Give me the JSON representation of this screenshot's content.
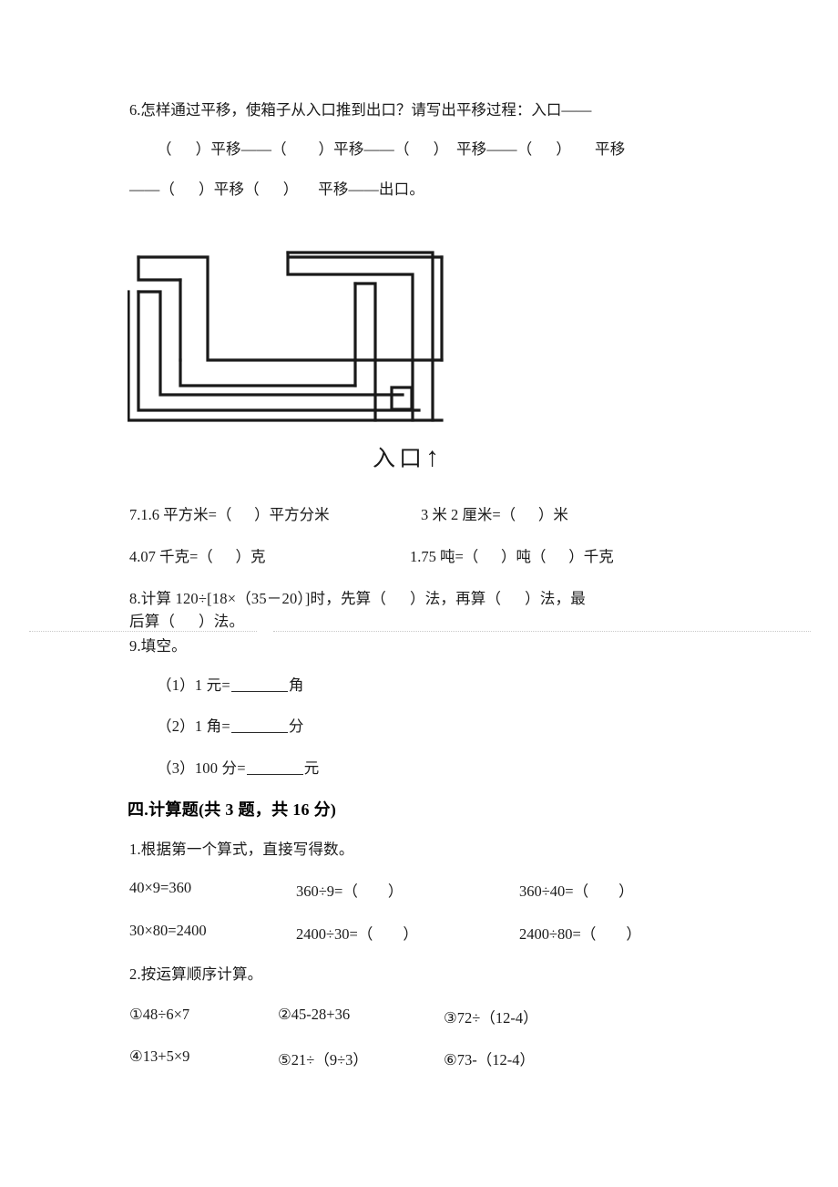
{
  "document": {
    "type": "math-worksheet",
    "language": "zh-CN"
  },
  "questions": {
    "q6": {
      "line1": "6.怎样通过平移，使箱子从入口推到出口？请写出平移过程：入口——",
      "line2": "（      ）平移——（        ）平移——（      ）  平移——（      ）      平移",
      "line3": "——（      ）平移（      ）     平移——出口。"
    },
    "q7": {
      "left1": "7.1.6 平方米=（      ）平方分米",
      "right1": "3 米 2 厘米=（      ）米",
      "left2": "4.07 千克=（      ）克",
      "right2": "1.75 吨=（      ）吨（      ）千克"
    },
    "q8": {
      "line1": "8.计算 120÷[18×（35－20）]时，先算（      ）法，再算（      ）法，最",
      "line2": "后算（      ）法。"
    },
    "q9": {
      "title": "9.填空。",
      "items": [
        {
          "prefix": "（1）1 元=",
          "suffix": "角"
        },
        {
          "prefix": "（2）1 角=",
          "suffix": "分"
        },
        {
          "prefix": "（3）100 分=",
          "suffix": "元"
        }
      ]
    }
  },
  "section4": {
    "title": "四.计算题(共 3 题，共 16 分)",
    "q1": {
      "prompt": "1.根据第一个算式，直接写得数。",
      "rows": [
        {
          "c1": "40×9=360",
          "c2": "360÷9=（        ）",
          "c3": "360÷40=（        ）"
        },
        {
          "c1": "30×80=2400",
          "c2": "2400÷30=（        ）",
          "c3": "2400÷80=（        ）"
        }
      ]
    },
    "q2": {
      "prompt": "2.按运算顺序计算。",
      "rows": [
        {
          "c1": "①48÷6×7",
          "c2": "②45-28+36",
          "c3": "③72÷（12-4）"
        },
        {
          "c1": "④13+5×9",
          "c2": "⑤21÷（9÷3）",
          "c3": "⑥73-（12-4）"
        }
      ]
    }
  },
  "figure": {
    "name": "maze-diagram",
    "entrance_label": "入口",
    "arrow": "↑",
    "stroke_color": "#1a1a1a"
  }
}
